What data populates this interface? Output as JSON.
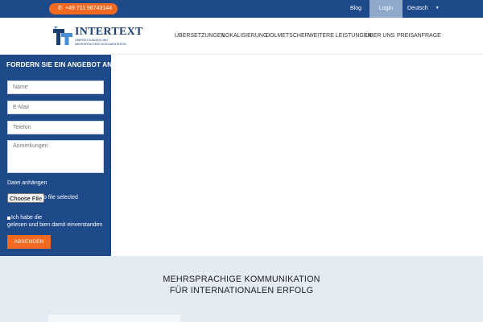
{
  "topbar": {
    "phone": "+49 711 96743144",
    "phone_icon": "phone-icon",
    "blog": "Blog",
    "login": "Login",
    "language": "Deutsch",
    "language_caret": "▼"
  },
  "brand": {
    "name": "INTERTEXT",
    "tagline_line1": "ÜBERSETZUNGEN UND",
    "tagline_line2": "MEHRSPRACHIGE DOKUMENTATION"
  },
  "nav": {
    "items": [
      "ÜBERSETZUNGEN",
      "LOKALISIERUNG",
      "DOLMETSCHER",
      "WEITERE LEISTUNGEN",
      "ÜBER UNS",
      "PREISANFRAGE"
    ]
  },
  "form": {
    "title": "FORDERN SIE EIN ANGEBOT AN",
    "name_placeholder": "Name",
    "email_placeholder": "E-Mail",
    "phone_placeholder": "Telefon",
    "notes_placeholder": "Anmerkungen",
    "attach_label": "Datei anhängen",
    "file_button": "Choose File",
    "file_status": "No file selected",
    "consent_line1": "Ich habe die",
    "consent_line2": "gelesen und bien damit einverstanden",
    "submit": "ABSENDEN"
  },
  "section": {
    "headline_line1": "MEHRSPRACHIGE KOMMUNIKATION",
    "headline_line2": "FÜR INTERNATIONALEN ERFOLG"
  },
  "colors": {
    "primary": "#1f4a8a",
    "accent": "#f26a22",
    "login_bg": "#8fa9cb",
    "section_bg": "#e4ebf2"
  }
}
